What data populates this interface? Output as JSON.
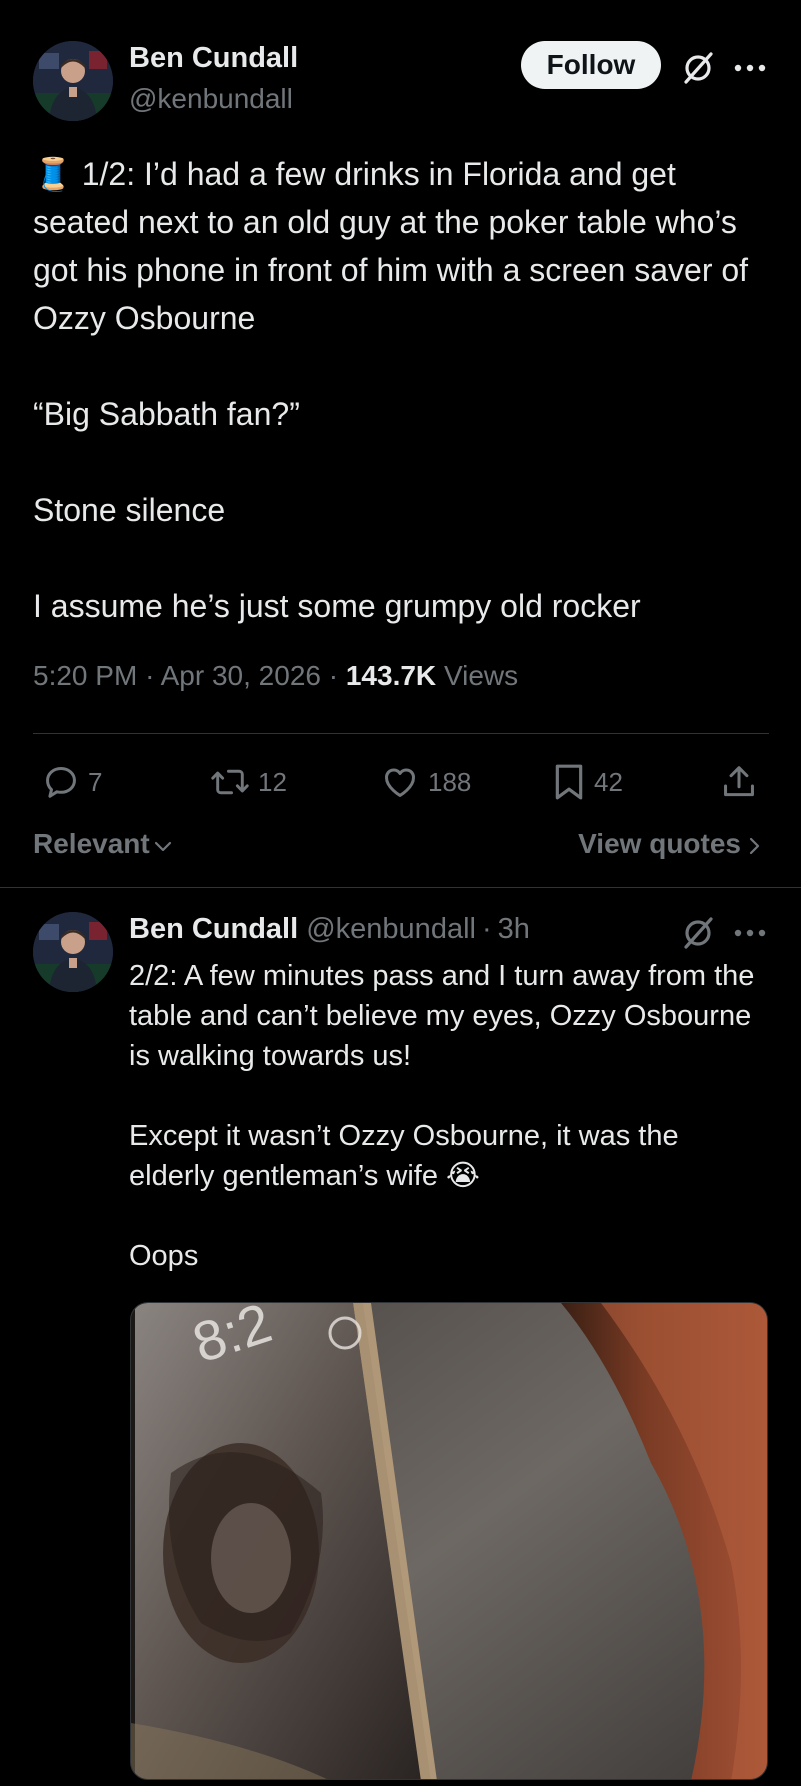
{
  "main_tweet": {
    "author_name": "Ben Cundall",
    "author_handle": "@kenbundall",
    "follow_label": "Follow",
    "thread_emoji": "🧵",
    "text_line1": "1/2: I’d had a few drinks in Florida and get seated next to an old guy at the poker table who’s got his phone in front of him with a screen saver of Ozzy Osbourne",
    "text_line2": "“Big Sabbath fan?”",
    "text_line3": "Stone silence",
    "text_line4": "I assume he’s just some grumpy old rocker",
    "time": "5:20 PM",
    "date": "Apr 30, 2026",
    "views_count": "143.7K",
    "views_label": "Views",
    "separator": "·",
    "actions": {
      "replies": "7",
      "reposts": "12",
      "likes": "188",
      "bookmarks": "42"
    },
    "sort_label": "Relevant",
    "view_quotes_label": "View quotes"
  },
  "reply_tweet": {
    "author_name": "Ben Cundall",
    "author_handle": "@kenbundall",
    "separator": "·",
    "time_ago": "3h",
    "text_line1": "2/2: A few minutes pass and I turn away from the table and can’t believe my eyes, Ozzy Osbourne is walking towards us!",
    "text_line2": "Except it wasn’t Ozzy Osbourne, it was the elderly gentleman’s wife",
    "emoji": "😭",
    "text_line3": "Oops"
  },
  "icons": [
    "grok-icon",
    "more-icon",
    "reply-icon",
    "repost-icon",
    "like-icon",
    "bookmark-icon",
    "share-icon",
    "chevron-down-icon",
    "chevron-right-icon"
  ],
  "colors": {
    "background": "#000000",
    "text": "#e7e9ea",
    "muted": "#71767b",
    "divider": "#2f3336",
    "follow_bg": "#eff3f4"
  }
}
